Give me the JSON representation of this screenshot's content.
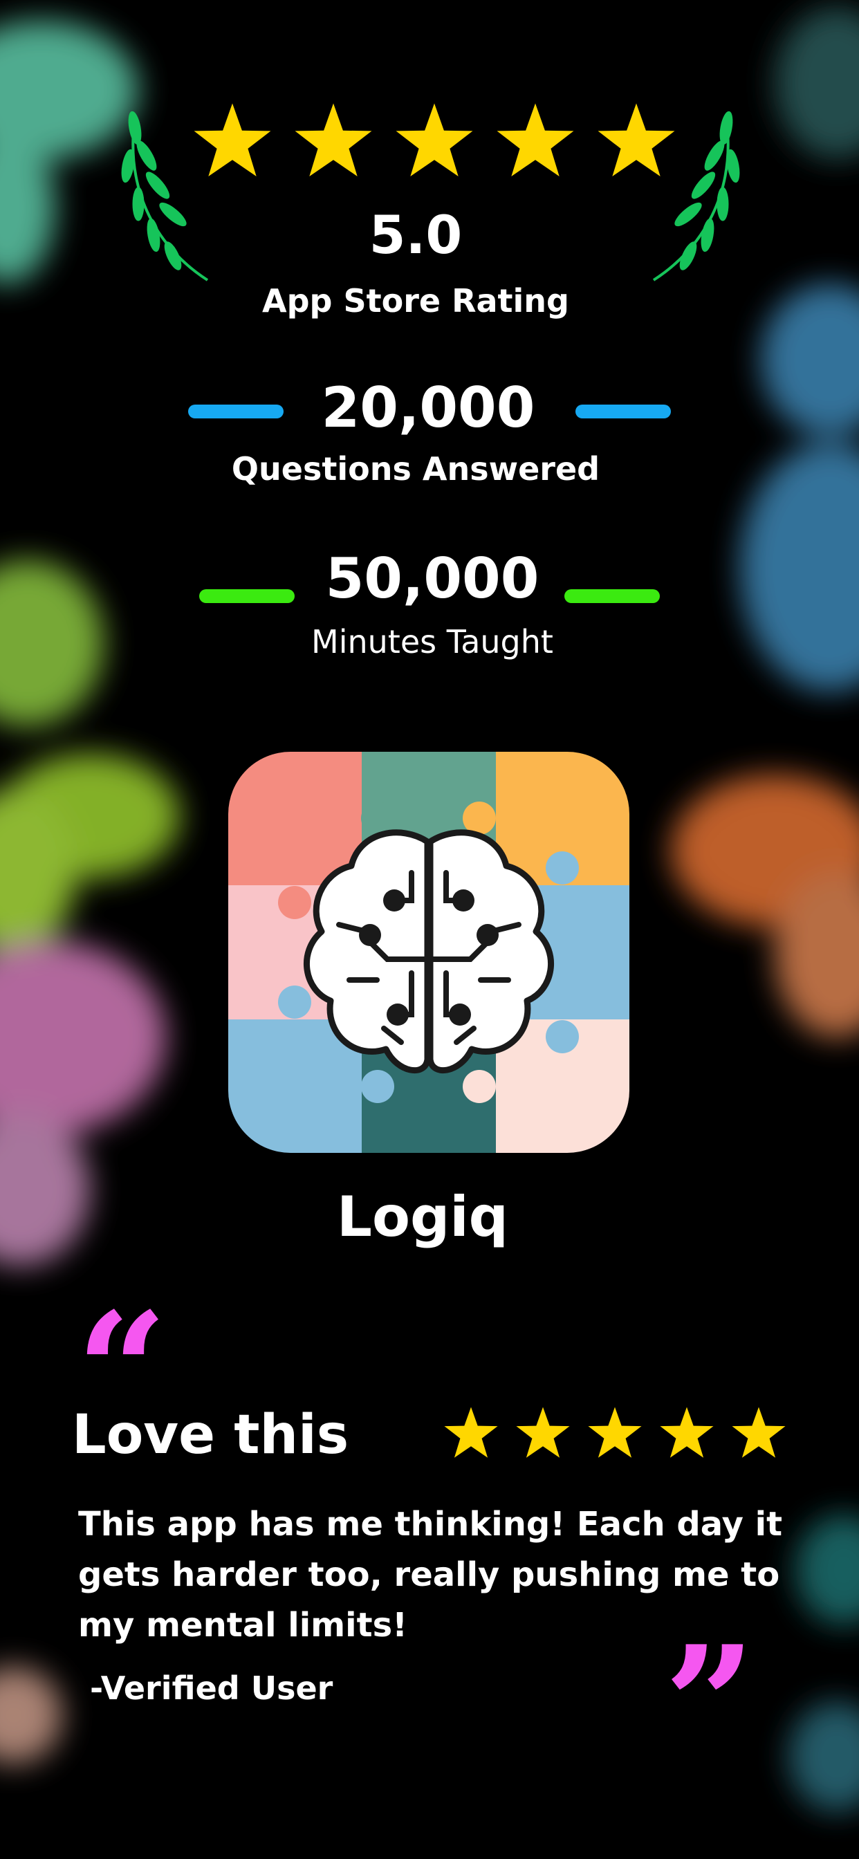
{
  "rating": {
    "value": "5.0",
    "label": "App Store Rating",
    "stars": 5,
    "star_color": "#FFD700",
    "laurel_color": "#16C45A"
  },
  "stats": [
    {
      "value": "20,000",
      "label": "Questions Answered",
      "accent": "#17A9F2"
    },
    {
      "value": "50,000",
      "label": "Minutes Taught",
      "accent": "#3BEA10"
    }
  ],
  "app": {
    "name": "Logiq",
    "icon": "brain-puzzle-icon"
  },
  "review": {
    "title": "Love this",
    "stars": 5,
    "body_lines": [
      "This app has me thinking! Each day it",
      "gets harder too, really pushing me to",
      "my mental limits!"
    ],
    "author": "-Verified User",
    "quote_open": "“",
    "quote_close": "”",
    "quote_color": "#F557F0"
  }
}
